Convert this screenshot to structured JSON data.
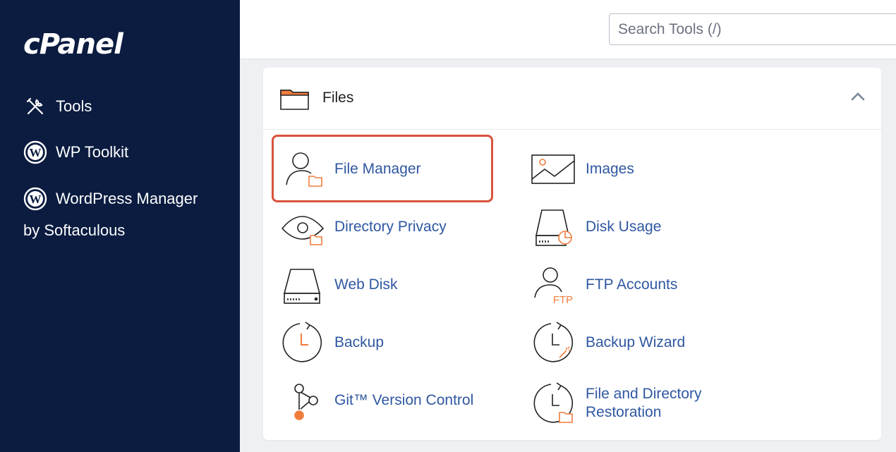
{
  "sidebar": {
    "logo": "cPanel",
    "items": [
      {
        "label": "Tools",
        "icon": "tools-icon"
      },
      {
        "label": "WP Toolkit",
        "icon": "wordpress-icon"
      },
      {
        "label": "WordPress Manager",
        "sublabel": "by Softaculous",
        "icon": "wordpress-icon"
      }
    ]
  },
  "header": {
    "search_placeholder": "Search Tools (/)"
  },
  "files_panel": {
    "title": "Files",
    "tools": [
      {
        "label": "File Manager",
        "icon": "user-folder-icon",
        "highlighted": true
      },
      {
        "label": "Images",
        "icon": "image-icon"
      },
      {
        "label": "Directory Privacy",
        "icon": "eye-folder-icon"
      },
      {
        "label": "Disk Usage",
        "icon": "disk-pie-icon"
      },
      {
        "label": "Web Disk",
        "icon": "drive-icon"
      },
      {
        "label": "FTP Accounts",
        "icon": "user-ftp-icon"
      },
      {
        "label": "Backup",
        "icon": "clock-icon"
      },
      {
        "label": "Backup Wizard",
        "icon": "clock-wand-icon"
      },
      {
        "label": "Git™ Version Control",
        "icon": "git-icon"
      },
      {
        "label": "File and Directory",
        "label2": "Restoration",
        "icon": "clock-folder-icon"
      }
    ]
  },
  "colors": {
    "sidebar_bg": "#0b1c40",
    "link": "#2f57a1",
    "accent_orange": "#f07c3c",
    "highlight": "#d9533e"
  }
}
